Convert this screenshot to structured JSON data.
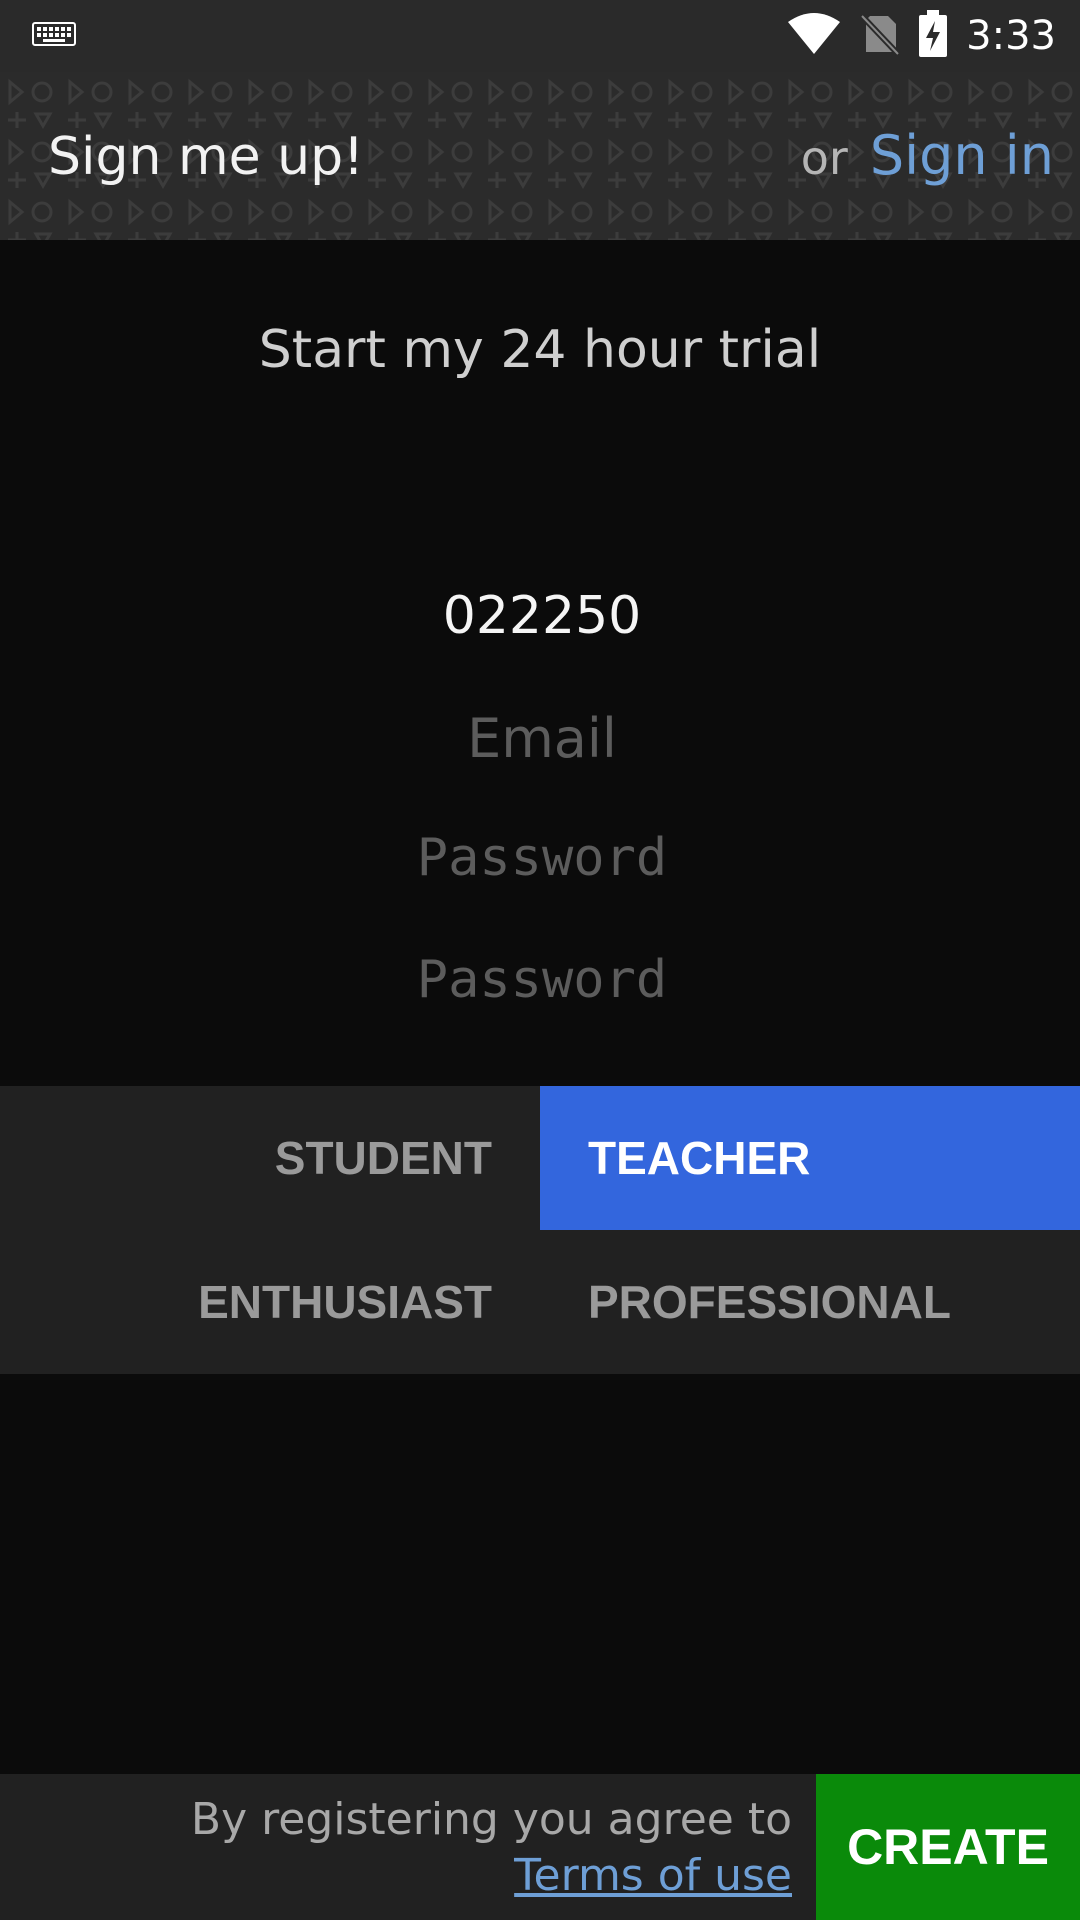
{
  "status_bar": {
    "time": "3:33",
    "icons": [
      "keyboard-icon",
      "wifi-icon",
      "no-sim-icon",
      "battery-charging-icon"
    ]
  },
  "header": {
    "title": "Sign me up!",
    "or_label": "or",
    "signin_label": "Sign in"
  },
  "form": {
    "heading": "Start my 24 hour trial",
    "code_value": "022250",
    "email_placeholder": "Email",
    "password_placeholder": "Password",
    "confirm_password_placeholder": "Password"
  },
  "roles": {
    "selected": "TEACHER",
    "items": [
      "STUDENT",
      "TEACHER",
      "ENTHUSIAST",
      "PROFESSIONAL"
    ]
  },
  "footer": {
    "agreement_text": "By registering you agree to",
    "terms_label": "Terms of use",
    "create_label": "CREATE"
  },
  "colors": {
    "accent_blue": "#3366dd",
    "link_blue": "#6e9fd6",
    "create_green": "#0a8a0a",
    "background": "#0b0b0b"
  }
}
